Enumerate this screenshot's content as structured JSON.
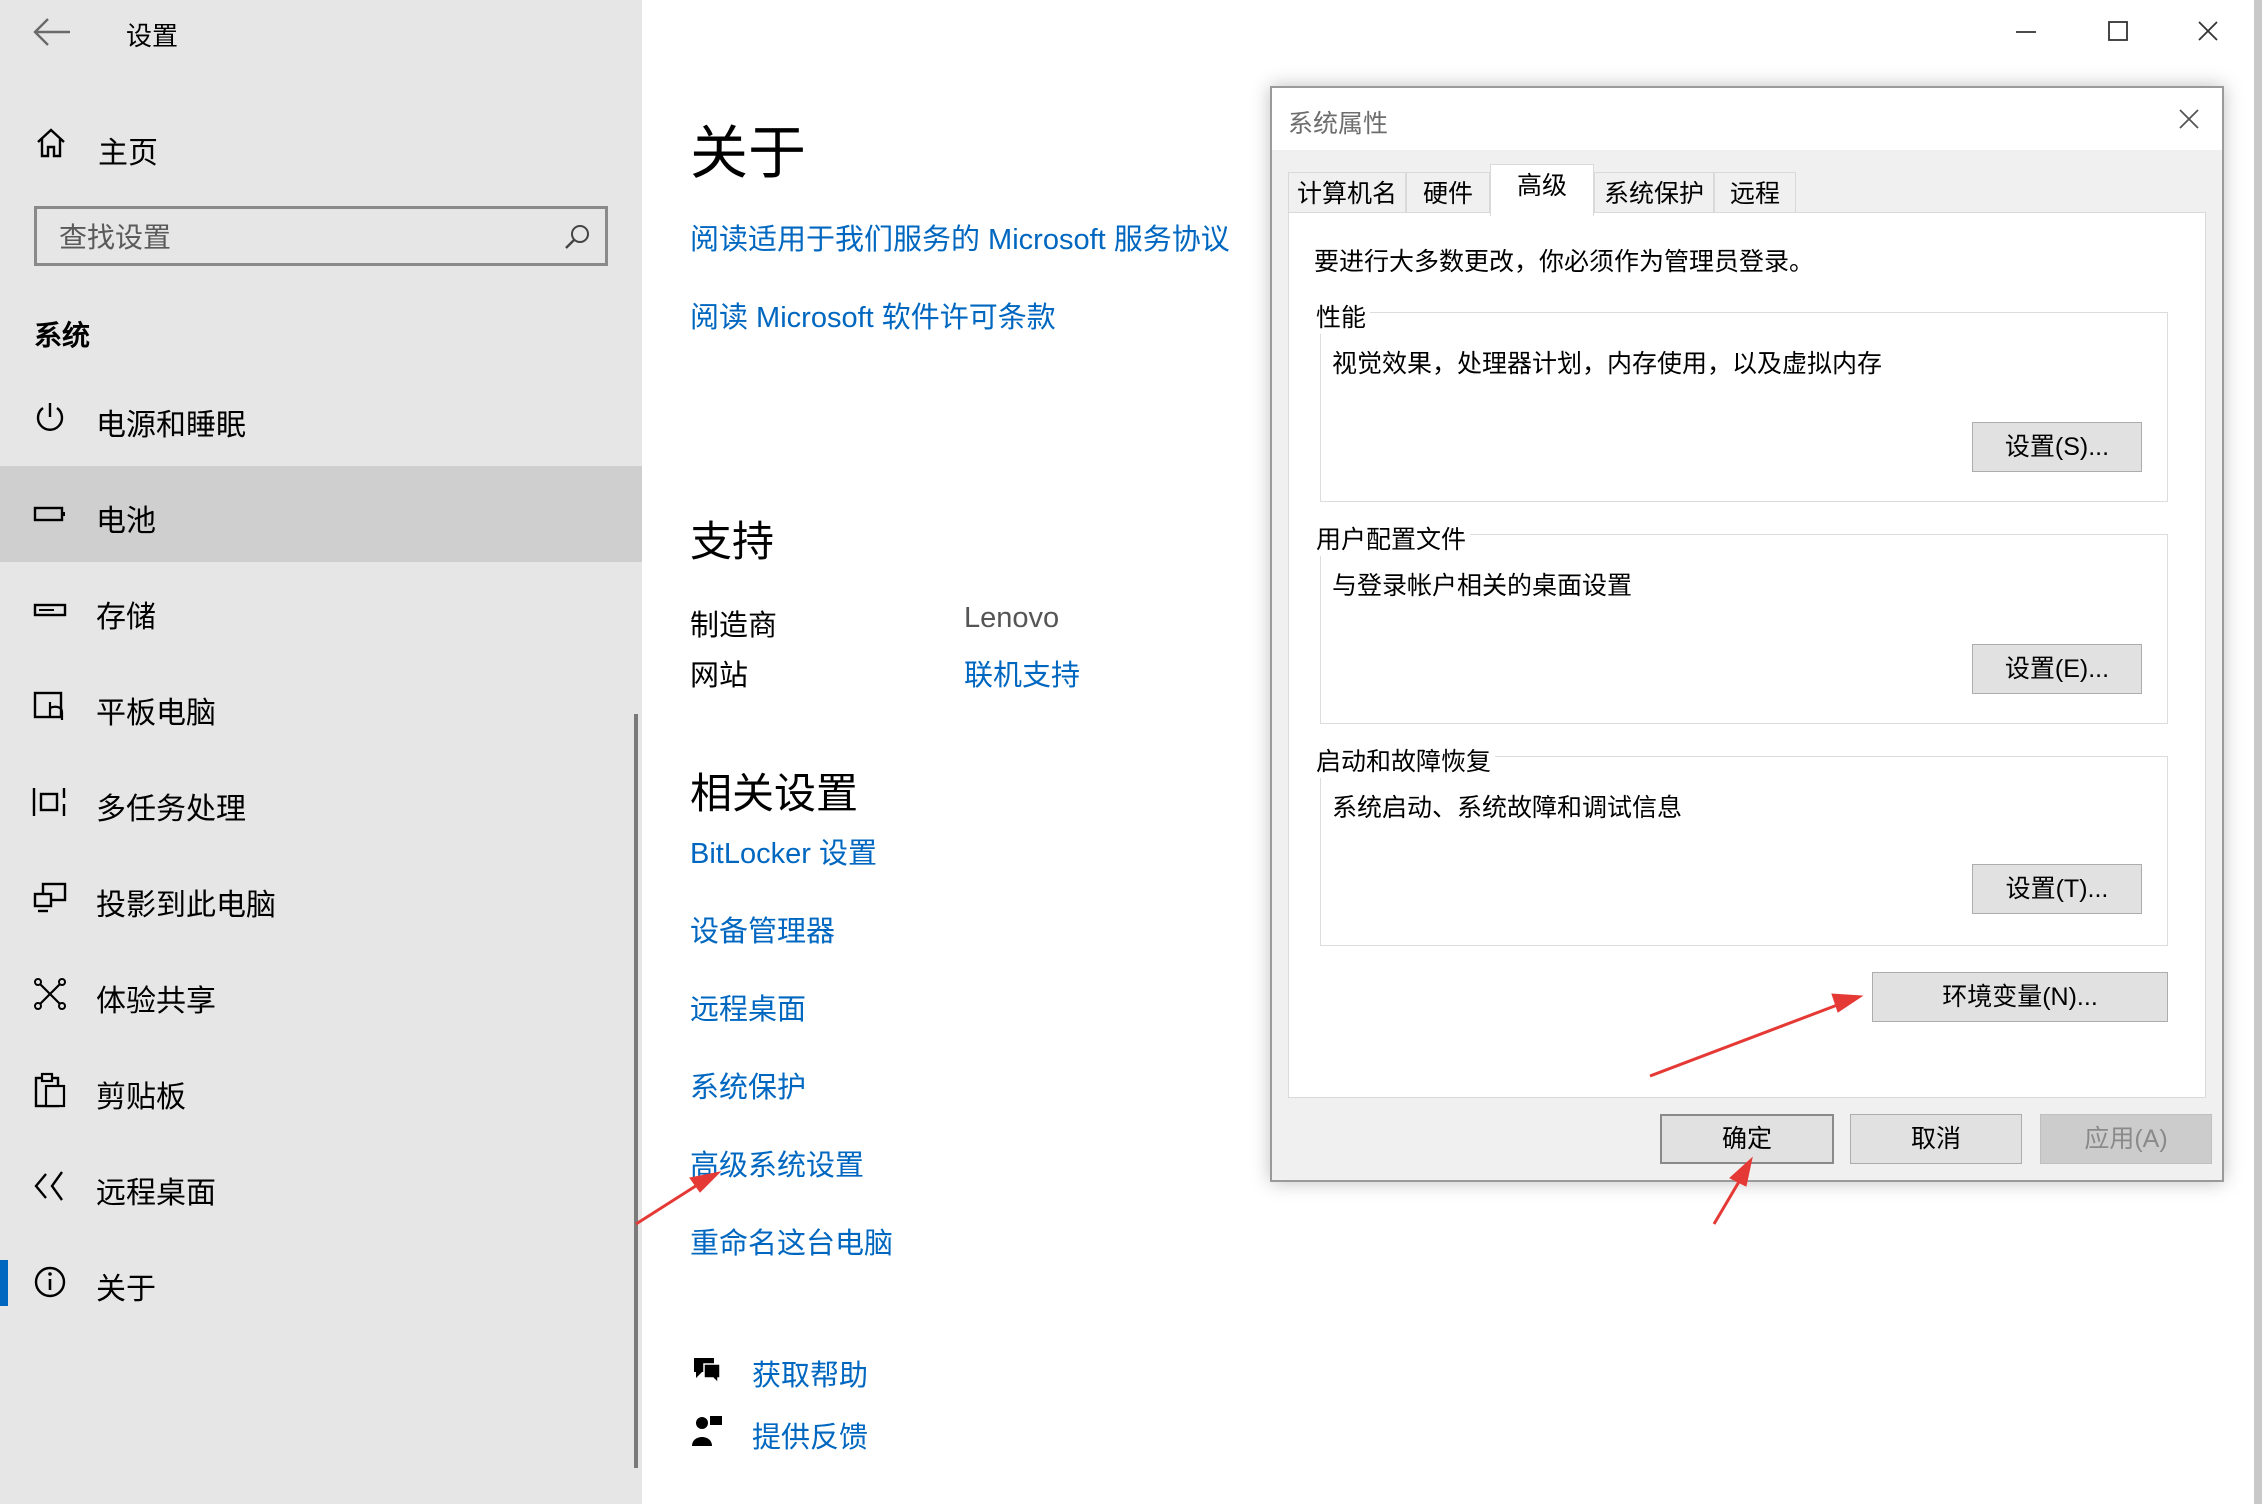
{
  "app": {
    "title": "设置"
  },
  "sidebar": {
    "home_label": "主页",
    "search_placeholder": "查找设置",
    "section_title": "系统",
    "items": [
      {
        "label": "电源和睡眠",
        "icon": "power-icon"
      },
      {
        "label": "电池",
        "icon": "battery-icon"
      },
      {
        "label": "存储",
        "icon": "storage-icon"
      },
      {
        "label": "平板电脑",
        "icon": "tablet-icon"
      },
      {
        "label": "多任务处理",
        "icon": "multitasking-icon"
      },
      {
        "label": "投影到此电脑",
        "icon": "projecting-icon"
      },
      {
        "label": "体验共享",
        "icon": "shared-experiences-icon"
      },
      {
        "label": "剪贴板",
        "icon": "clipboard-icon"
      },
      {
        "label": "远程桌面",
        "icon": "remote-desktop-icon"
      },
      {
        "label": "关于",
        "icon": "info-icon"
      }
    ]
  },
  "main": {
    "title": "关于",
    "links_top": [
      "阅读适用于我们服务的 Microsoft 服务协议",
      "阅读 Microsoft 软件许可条款"
    ],
    "support": {
      "title": "支持",
      "manufacturer_label": "制造商",
      "manufacturer_value": "Lenovo",
      "website_label": "网站",
      "website_value": "联机支持"
    },
    "related": {
      "title": "相关设置",
      "links": [
        "BitLocker 设置",
        "设备管理器",
        "远程桌面",
        "系统保护",
        "高级系统设置",
        "重命名这台电脑"
      ]
    },
    "help": {
      "get_help": "获取帮助",
      "feedback": "提供反馈"
    }
  },
  "dialog": {
    "title": "系统属性",
    "tabs": [
      "计算机名",
      "硬件",
      "高级",
      "系统保护",
      "远程"
    ],
    "active_tab": "高级",
    "admin_note": "要进行大多数更改，你必须作为管理员登录。",
    "groups": [
      {
        "title": "性能",
        "desc": "视觉效果，处理器计划，内存使用，以及虚拟内存",
        "button": "设置(S)..."
      },
      {
        "title": "用户配置文件",
        "desc": "与登录帐户相关的桌面设置",
        "button": "设置(E)..."
      },
      {
        "title": "启动和故障恢复",
        "desc": "系统启动、系统故障和调试信息",
        "button": "设置(T)..."
      }
    ],
    "env_button": "环境变量(N)...",
    "ok": "确定",
    "cancel": "取消",
    "apply": "应用(A)"
  },
  "colors": {
    "accent": "#0067c0",
    "arrow": "#e53935"
  }
}
